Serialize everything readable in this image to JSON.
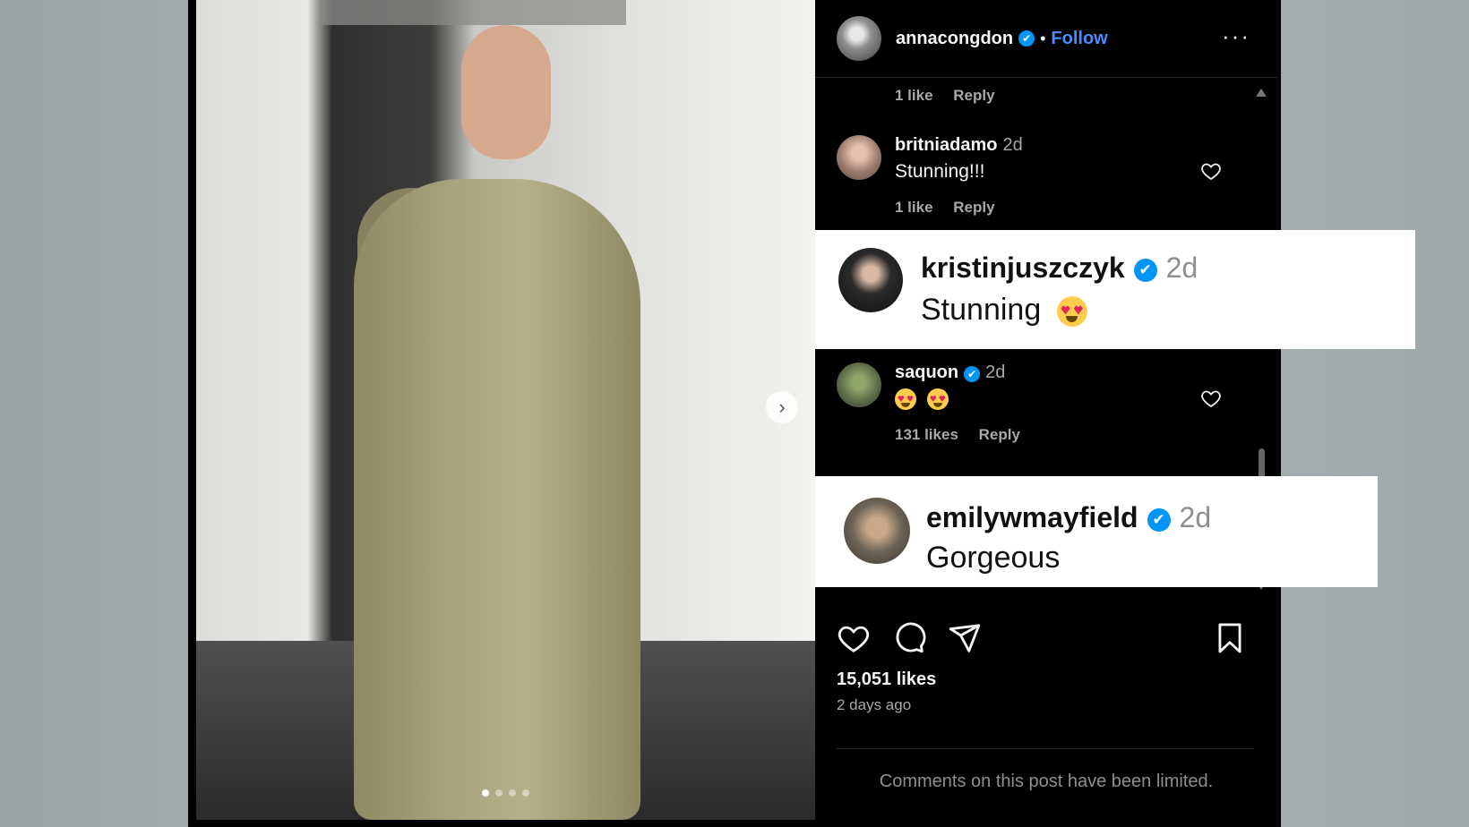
{
  "post": {
    "author": "annacongdon",
    "follow_label": "Follow",
    "separator": "•",
    "more_label": "···",
    "verified_mark": "✔",
    "next_label": "›",
    "carousel_count": 4
  },
  "comments": {
    "top_partial": {
      "likes": "1 like",
      "reply": "Reply"
    },
    "items": [
      {
        "user": "britniadamo",
        "time": "2d",
        "text": "Stunning!!!",
        "likes": "1 like",
        "reply": "Reply"
      },
      {
        "user": "saquon",
        "time": "2d",
        "text": "",
        "likes": "131 likes",
        "reply": "Reply"
      }
    ]
  },
  "highlights": [
    {
      "user": "kristinjuszczyk",
      "time": "2d",
      "text": "Stunning"
    },
    {
      "user": "emilywmayfield",
      "time": "2d",
      "text": "Gorgeous"
    }
  ],
  "footer": {
    "likes": "15,051 likes",
    "date": "2 days ago",
    "limited_notice": "Comments on this post have been limited."
  },
  "colors": {
    "accent": "#0095f6",
    "follow": "#4a8cff",
    "panel_bg": "#000000",
    "highlight_bg": "#ffffff"
  },
  "icons": [
    "heart-icon",
    "comment-icon",
    "share-icon",
    "bookmark-icon",
    "verified-badge-icon",
    "chevron-right-icon",
    "more-icon",
    "heart-eyes-emoji"
  ]
}
